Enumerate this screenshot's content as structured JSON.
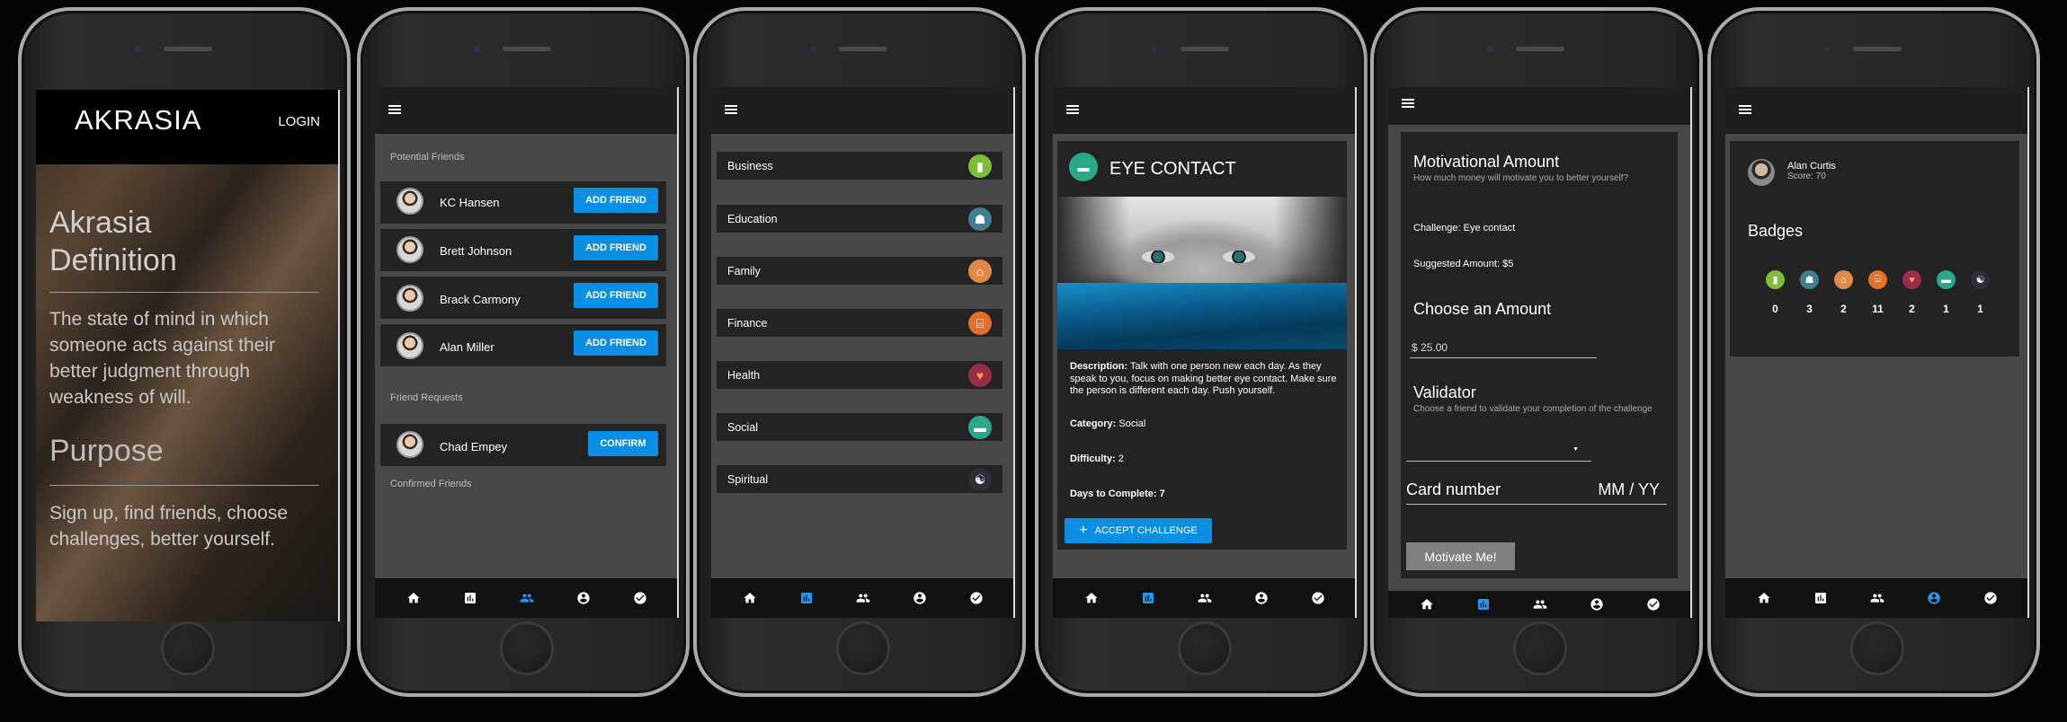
{
  "colors": {
    "accent_blue": "#0a8fe5",
    "app_bar": "#1e1e1e",
    "card": "#232323",
    "screen_bg": "#484848"
  },
  "phone1": {
    "brand": "AKRASIA",
    "login": "LOGIN",
    "definition_title": "Akrasia Definition",
    "definition_text": "The state of mind in which someone acts against their better judgment through weakness of will.",
    "purpose_title": "Purpose",
    "purpose_text": "Sign up, find friends, choose challenges, better yourself."
  },
  "phone2": {
    "potential_heading": "Potential Friends",
    "potential": [
      {
        "name": "KC Hansen",
        "button": "ADD FRIEND"
      },
      {
        "name": "Brett Johnson",
        "button": "ADD FRIEND"
      },
      {
        "name": "Brack Carmony",
        "button": "ADD FRIEND"
      },
      {
        "name": "Alan Miller",
        "button": "ADD FRIEND"
      }
    ],
    "requests_heading": "Friend Requests",
    "requests": [
      {
        "name": "Chad Empey",
        "button": "CONFIRM"
      }
    ],
    "confirmed_heading": "Confirmed Friends"
  },
  "phone3": {
    "categories": [
      {
        "label": "Business",
        "icon": "chart-icon",
        "color": "#7cbd3a"
      },
      {
        "label": "Education",
        "icon": "graduate-icon",
        "color": "#3f7f8f"
      },
      {
        "label": "Family",
        "icon": "house-icon",
        "color": "#e08a4a"
      },
      {
        "label": "Finance",
        "icon": "bank-icon",
        "color": "#e0702a"
      },
      {
        "label": "Health",
        "icon": "heart-icon",
        "color": "#9a2c4a"
      },
      {
        "label": "Social",
        "icon": "chat-icon",
        "color": "#2aa88a"
      },
      {
        "label": "Spiritual",
        "icon": "yinyang-icon",
        "color": "#2a2f38"
      }
    ]
  },
  "phone4": {
    "title": "EYE CONTACT",
    "description_label": "Description:",
    "description": "Talk with one person new each day. As they speak to you, focus on making better eye contact. Make sure the person is different each day. Push yourself.",
    "category_label": "Category:",
    "category": "Social",
    "difficulty_label": "Difficulty:",
    "difficulty": "2",
    "days_label": "Days to Complete:",
    "days": "7",
    "accept": "ACCEPT CHALLENGE"
  },
  "phone5": {
    "motivational_title": "Motivational Amount",
    "motivational_sub": "How much money will motivate you to better yourself?",
    "challenge": "Challenge: Eye contact",
    "suggested": "Suggested Amount: $5",
    "choose_title": "Choose an Amount",
    "amount_value": "$ 25.00",
    "validator_title": "Validator",
    "validator_sub": "Choose a friend to validate your completion of the challenge",
    "card_number_placeholder": "Card number",
    "expiry_placeholder": "MM / YY",
    "motivate_button": "Motivate Me!"
  },
  "phone6": {
    "user_name": "Alan Curtis",
    "score": "Score: 70",
    "badges_title": "Badges",
    "badges": [
      {
        "icon": "chart-icon",
        "color": "#7cbd3a",
        "count": "0"
      },
      {
        "icon": "graduate-icon",
        "color": "#3f7f8f",
        "count": "3"
      },
      {
        "icon": "house-icon",
        "color": "#e08a4a",
        "count": "2"
      },
      {
        "icon": "bank-icon",
        "color": "#e0702a",
        "count": "11"
      },
      {
        "icon": "heart-icon",
        "color": "#9a2c4a",
        "count": "2"
      },
      {
        "icon": "chat-icon",
        "color": "#2aa88a",
        "count": "1"
      },
      {
        "icon": "yinyang-icon",
        "color": "#2a2f38",
        "count": "1"
      }
    ]
  },
  "nav": {
    "items": [
      "home-icon",
      "chart-icon",
      "people-icon",
      "account-icon",
      "check-circle-icon"
    ]
  }
}
